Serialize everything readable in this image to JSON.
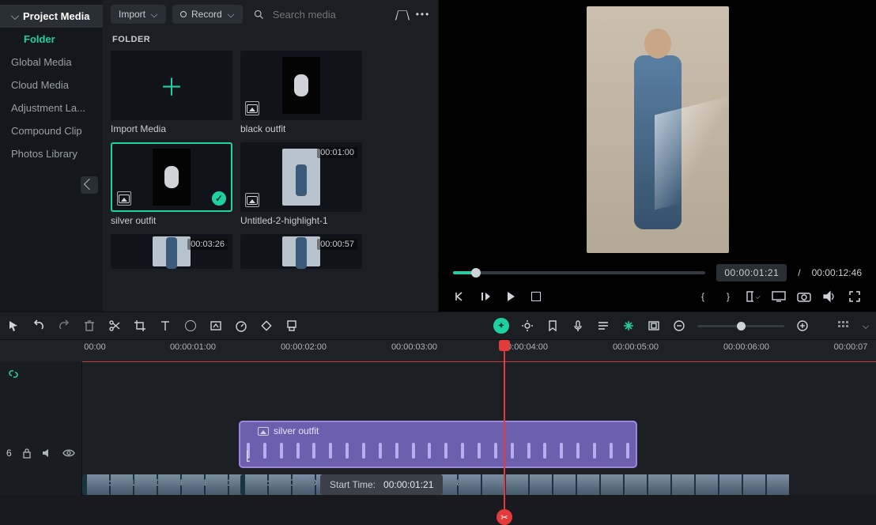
{
  "sidebar": {
    "project": "Project Media",
    "folder": "Folder",
    "items": [
      "Global Media",
      "Cloud Media",
      "Adjustment La...",
      "Compound Clip",
      "Photos Library"
    ]
  },
  "library": {
    "importLabel": "Import",
    "recordLabel": "Record",
    "searchPlaceholder": "Search media",
    "folderHeading": "FOLDER",
    "tiles": {
      "importMedia": "Import Media",
      "black": "black outfit",
      "silver": "silver outfit",
      "untitled": "Untitled-2-highlight-1",
      "dur_untitled": "00:01:00",
      "dur_a": "00:03:26",
      "dur_b": "00:00:57"
    }
  },
  "preview": {
    "current": "00:00:01:21",
    "sep": "/",
    "total": "00:00:12:46",
    "progressPct": 9
  },
  "ruler": {
    "t0": "00:00",
    "t1": "00:00:01:00",
    "t2": "00:00:02:00",
    "t3": "00:00:03:00",
    "t4": "00:00:04:00",
    "t5": "00:00:05:00",
    "t6": "00:00:06:00",
    "t7": "00:00:07"
  },
  "trackHeader": {
    "num": "6"
  },
  "clip": {
    "name": "silver outfit",
    "leftPx": 302,
    "widthPx": 504
  },
  "video": {
    "aLabel": "copy_1105E7D4-E6F8-4BB6-821",
    "bLabel": "copy_5DE32D24-116F-4042-A3EE-5776C18C7D08",
    "aLeft": 104,
    "aWidth": 200,
    "bLeft": 304,
    "bWidth": 686
  },
  "playheadPx": 637,
  "startPopup": {
    "label": "Start Time:",
    "value": "00:00:01:21"
  },
  "zoomPct": 45
}
